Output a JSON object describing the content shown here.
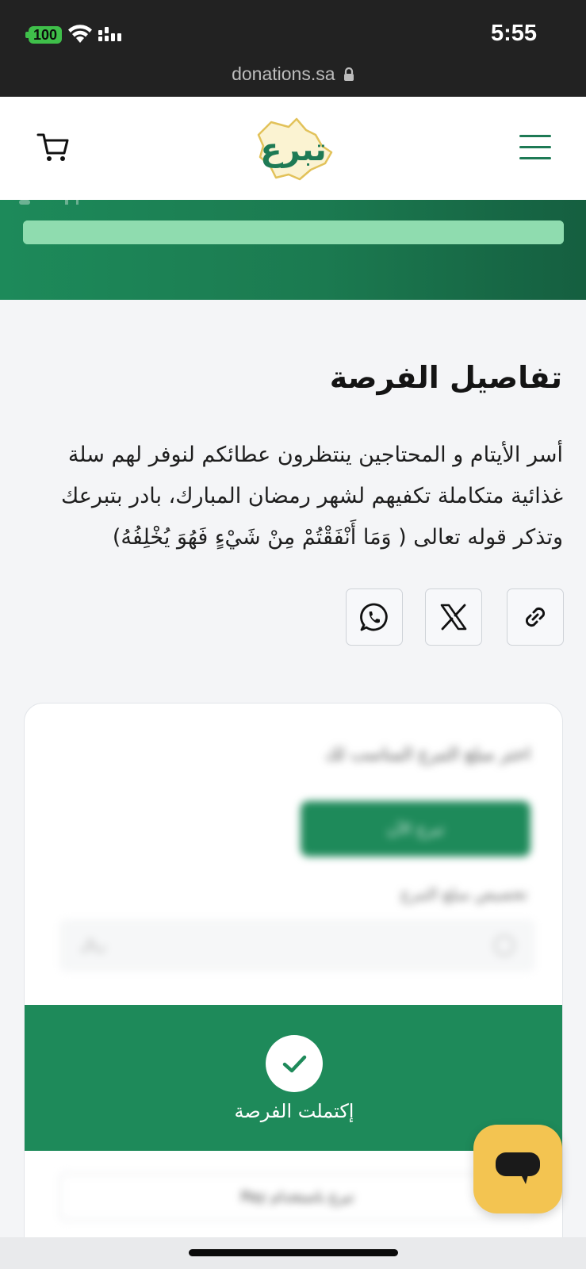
{
  "status_bar": {
    "battery": "100",
    "time": "5:55",
    "url": "donations.sa"
  },
  "header": {
    "logo_text": "تبرع",
    "menu_icon": "hamburger-menu-icon",
    "cart_icon": "shopping-cart-icon"
  },
  "hero": {
    "progress_percent": 100
  },
  "details": {
    "title": "تفاصيل الفرصة",
    "description": "أسر الأيتام و المحتاجين ينتظرون عطائكم لنوفر لهم سلة غذائية متكاملة تكفيهم لشهر رمضان المبارك، بادر بتبرعك وتذكر قوله تعالى ( وَمَا أَنْفَقْتُمْ مِنْ شَيْءٍ فَهُوَ يُخْلِفُهُ)"
  },
  "share": {
    "buttons": [
      "whatsapp-icon",
      "x-icon",
      "link-icon"
    ]
  },
  "donation_card": {
    "heading": "اختر مبلغ التبرع المناسب لك",
    "primary_button": "تبرع الآن",
    "amount_label": "تخصيص مبلغ التبرع",
    "amount_placeholder": "ريال",
    "completed_text": "إكتملت الفرصة",
    "apple_pay_button": "تبرع باستخدام Pay"
  },
  "colors": {
    "brand_green": "#1e8a5a",
    "progress_green": "#8fdcaf",
    "chat_yellow": "#f3c451",
    "status_bar": "#222222"
  }
}
